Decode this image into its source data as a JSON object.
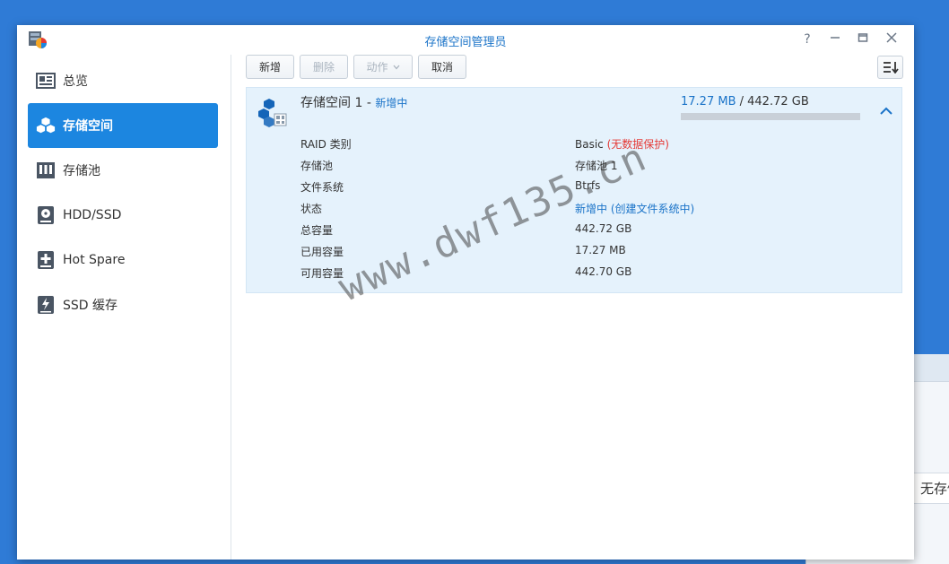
{
  "window": {
    "title": "存储空间管理员"
  },
  "sidebar": {
    "items": [
      {
        "label": "总览",
        "icon": "overview-icon",
        "active": false
      },
      {
        "label": "存储空间",
        "icon": "volume-icon",
        "active": true
      },
      {
        "label": "存储池",
        "icon": "storage-pool-icon",
        "active": false
      },
      {
        "label": "HDD/SSD",
        "icon": "disk-icon",
        "active": false
      },
      {
        "label": "Hot Spare",
        "icon": "hot-spare-icon",
        "active": false
      },
      {
        "label": "SSD 缓存",
        "icon": "ssd-cache-icon",
        "active": false
      }
    ]
  },
  "toolbar": {
    "create_label": "新增",
    "delete_label": "删除",
    "action_label": "动作",
    "cancel_label": "取消"
  },
  "volume": {
    "name": "存储空间 1",
    "separator": "-",
    "status": "新增中",
    "used": "17.27 MB",
    "usage_sep": " / ",
    "total": "442.72 GB",
    "usage_fraction": 0.0,
    "details": [
      {
        "key": "RAID 类别",
        "value": "Basic",
        "note": "(无数据保护)"
      },
      {
        "key": "存储池",
        "value": "存储池 1"
      },
      {
        "key": "文件系统",
        "value": "Btrfs"
      },
      {
        "key": "状态",
        "value": "新增中",
        "note": "(创建文件系统中)"
      },
      {
        "key": "总容量",
        "value": "442.72 GB"
      },
      {
        "key": "已用容量",
        "value": "17.27 MB"
      },
      {
        "key": "可用容量",
        "value": "442.70 GB"
      }
    ]
  },
  "background_window": {
    "hint": "无存储"
  },
  "watermark": "www.dwf135.cn",
  "colors": {
    "accent": "#1c86e0",
    "link": "#1a73c8",
    "warning": "#e53935",
    "panel_bg": "#e5f2fc",
    "desktop": "#2f7bd6"
  }
}
